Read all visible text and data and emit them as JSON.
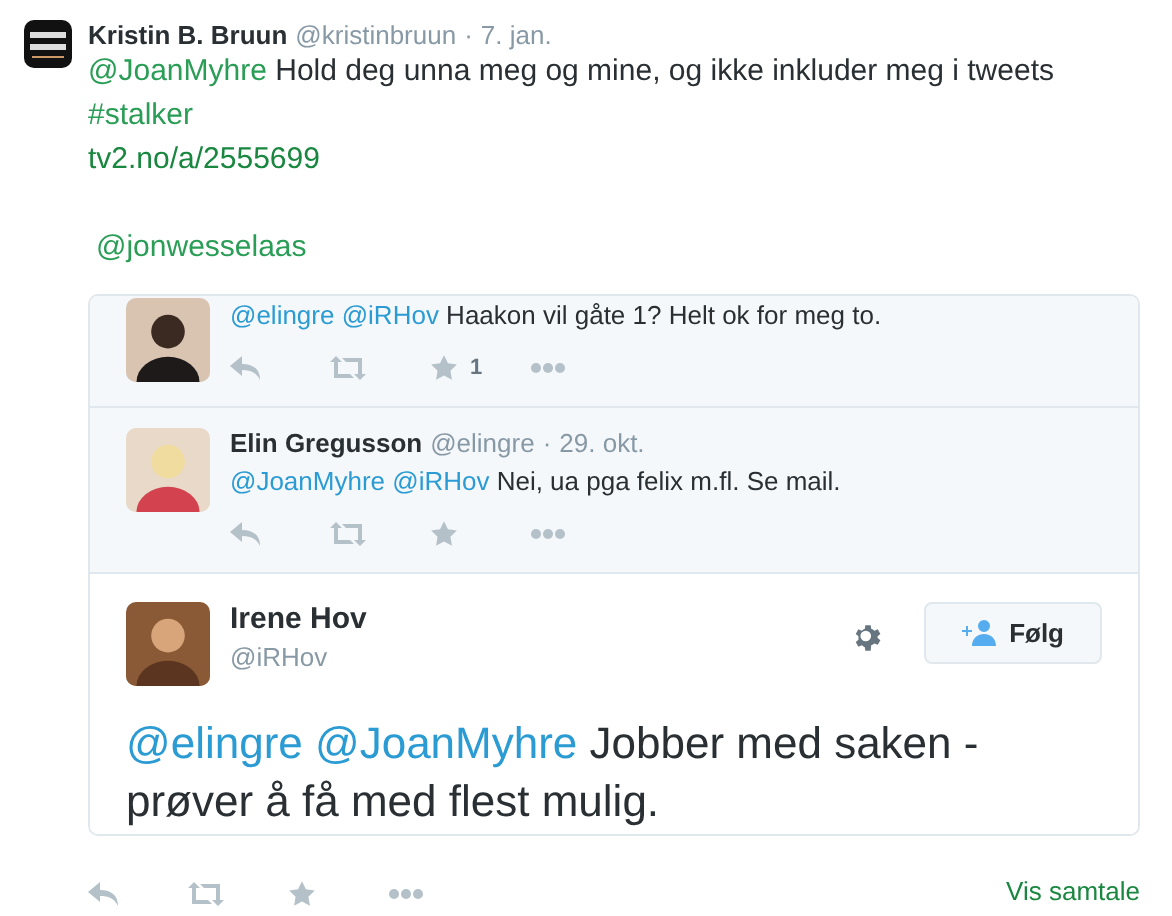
{
  "tweet": {
    "name": "Kristin B. Bruun",
    "handle": "@kristinbruun",
    "separator": "·",
    "date": "7. jan.",
    "lines": [
      [
        {
          "kind": "mention",
          "text": "@JoanMyhre"
        },
        {
          "kind": "text",
          "text": " Hold deg unna meg og mine, og ikke inkluder meg i tweets"
        }
      ],
      [
        {
          "kind": "mention",
          "text": "#stalker"
        }
      ],
      [
        {
          "kind": "link",
          "text": "tv2.no/a/2555699"
        }
      ]
    ],
    "closing_mention": "@jonwesselaas"
  },
  "embed": {
    "replies": [
      {
        "parts": [
          {
            "kind": "mention",
            "text": "@elingre"
          },
          {
            "kind": "mention",
            "text": " @iRHov"
          },
          {
            "kind": "text",
            "text": " Haakon vil gåte 1? Helt  ok for meg to."
          }
        ],
        "favorite_count": "1"
      },
      {
        "name": "Elin Gregusson",
        "handle": "@elingre",
        "separator": "·",
        "date": "29. okt.",
        "parts": [
          {
            "kind": "mention",
            "text": "@JoanMyhre"
          },
          {
            "kind": "mention",
            "text": " @iRHov"
          },
          {
            "kind": "text",
            "text": " Nei, ua pga felix m.fl. Se mail."
          }
        ]
      }
    ],
    "main": {
      "name": "Irene Hov",
      "handle": "@iRHov",
      "follow_label": "Følg",
      "parts": [
        {
          "kind": "mention",
          "text": "@elingre"
        },
        {
          "kind": "mention",
          "text": " @JoanMyhre"
        },
        {
          "kind": "text",
          "text": " Jobber med saken - prøver å få med flest mulig."
        }
      ]
    }
  },
  "footer": {
    "conversation_link": "Vis samtale"
  }
}
